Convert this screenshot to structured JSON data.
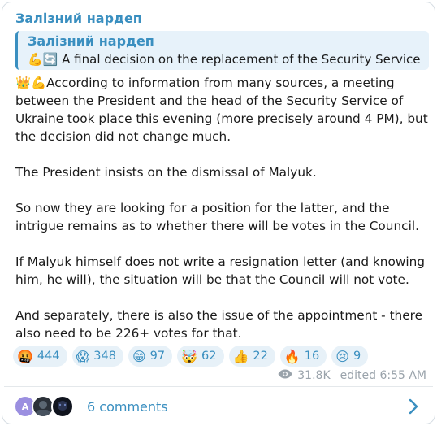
{
  "channel": {
    "name": "Залізний нардеп"
  },
  "reply": {
    "title": "Залізний нардеп",
    "emoji": "💪🔄",
    "text": "A final decision on the replacement of the Security Service"
  },
  "post": {
    "lead_emoji": "👑💪",
    "paragraphs": [
      "According to information from many sources, a meeting between the President and the head of the Security Service of Ukraine took place this evening (more precisely around 4 PM), but the decision did not change much.",
      "The President insists on the dismissal of Malyuk.",
      "So now they are looking for a position for the latter, and the intrigue remains as to whether there will be votes in the Council.",
      "If Malyuk himself does not write a resignation letter (and knowing him, he will), the situation will be that the Council will not vote.",
      "And separately, there is also the issue of the appointment - there also need to be 226+ votes for that."
    ]
  },
  "reactions": [
    {
      "emoji": "🤬",
      "count": "444"
    },
    {
      "emoji": "😱",
      "count": "348"
    },
    {
      "emoji": "😁",
      "count": "97"
    },
    {
      "emoji": "🤯",
      "count": "62"
    },
    {
      "emoji": "👍",
      "count": "22"
    },
    {
      "emoji": "🔥",
      "count": "16"
    },
    {
      "emoji": "😢",
      "count": "9"
    }
  ],
  "meta": {
    "views": "31.8K",
    "edited": "edited 6:55 AM",
    "icon": "eye-icon"
  },
  "comments": {
    "avatar_initial": "A",
    "label": "6 comments",
    "icon": "chevron-right-icon"
  },
  "colors": {
    "accent": "#3a8fc0",
    "reply_bg": "#e7f2fa",
    "reaction_bg": "#e7f1f8",
    "meta": "#9aa3ab"
  }
}
